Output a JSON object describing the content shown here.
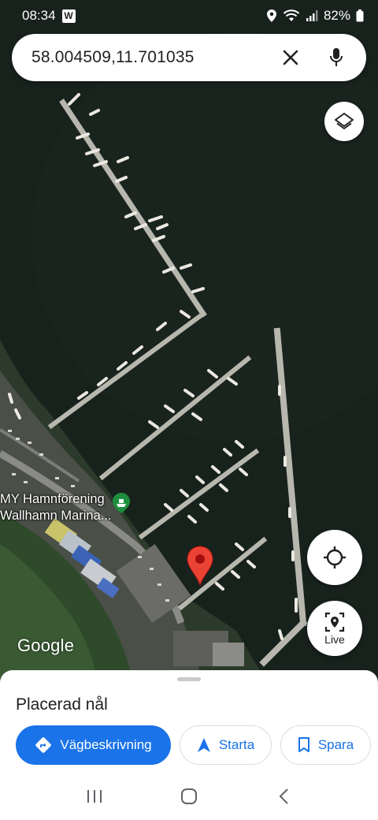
{
  "status_bar": {
    "time": "08:34",
    "app_badge": "W",
    "battery": "82%"
  },
  "search": {
    "query": "58.004509,11.701035"
  },
  "map": {
    "type": "satellite",
    "poi_label_line1": "MY Hamnförening",
    "poi_label_line2": "Wallhamn Marina...",
    "attribution": "Google"
  },
  "controls": {
    "live_label": "Live"
  },
  "sheet": {
    "title": "Placerad nål",
    "directions_label": "Vägbeskrivning",
    "start_label": "Starta",
    "save_label": "Spara"
  },
  "colors": {
    "accent": "#1a73e8",
    "pin": "#ea4335",
    "poi_green": "#1e8e3e"
  }
}
